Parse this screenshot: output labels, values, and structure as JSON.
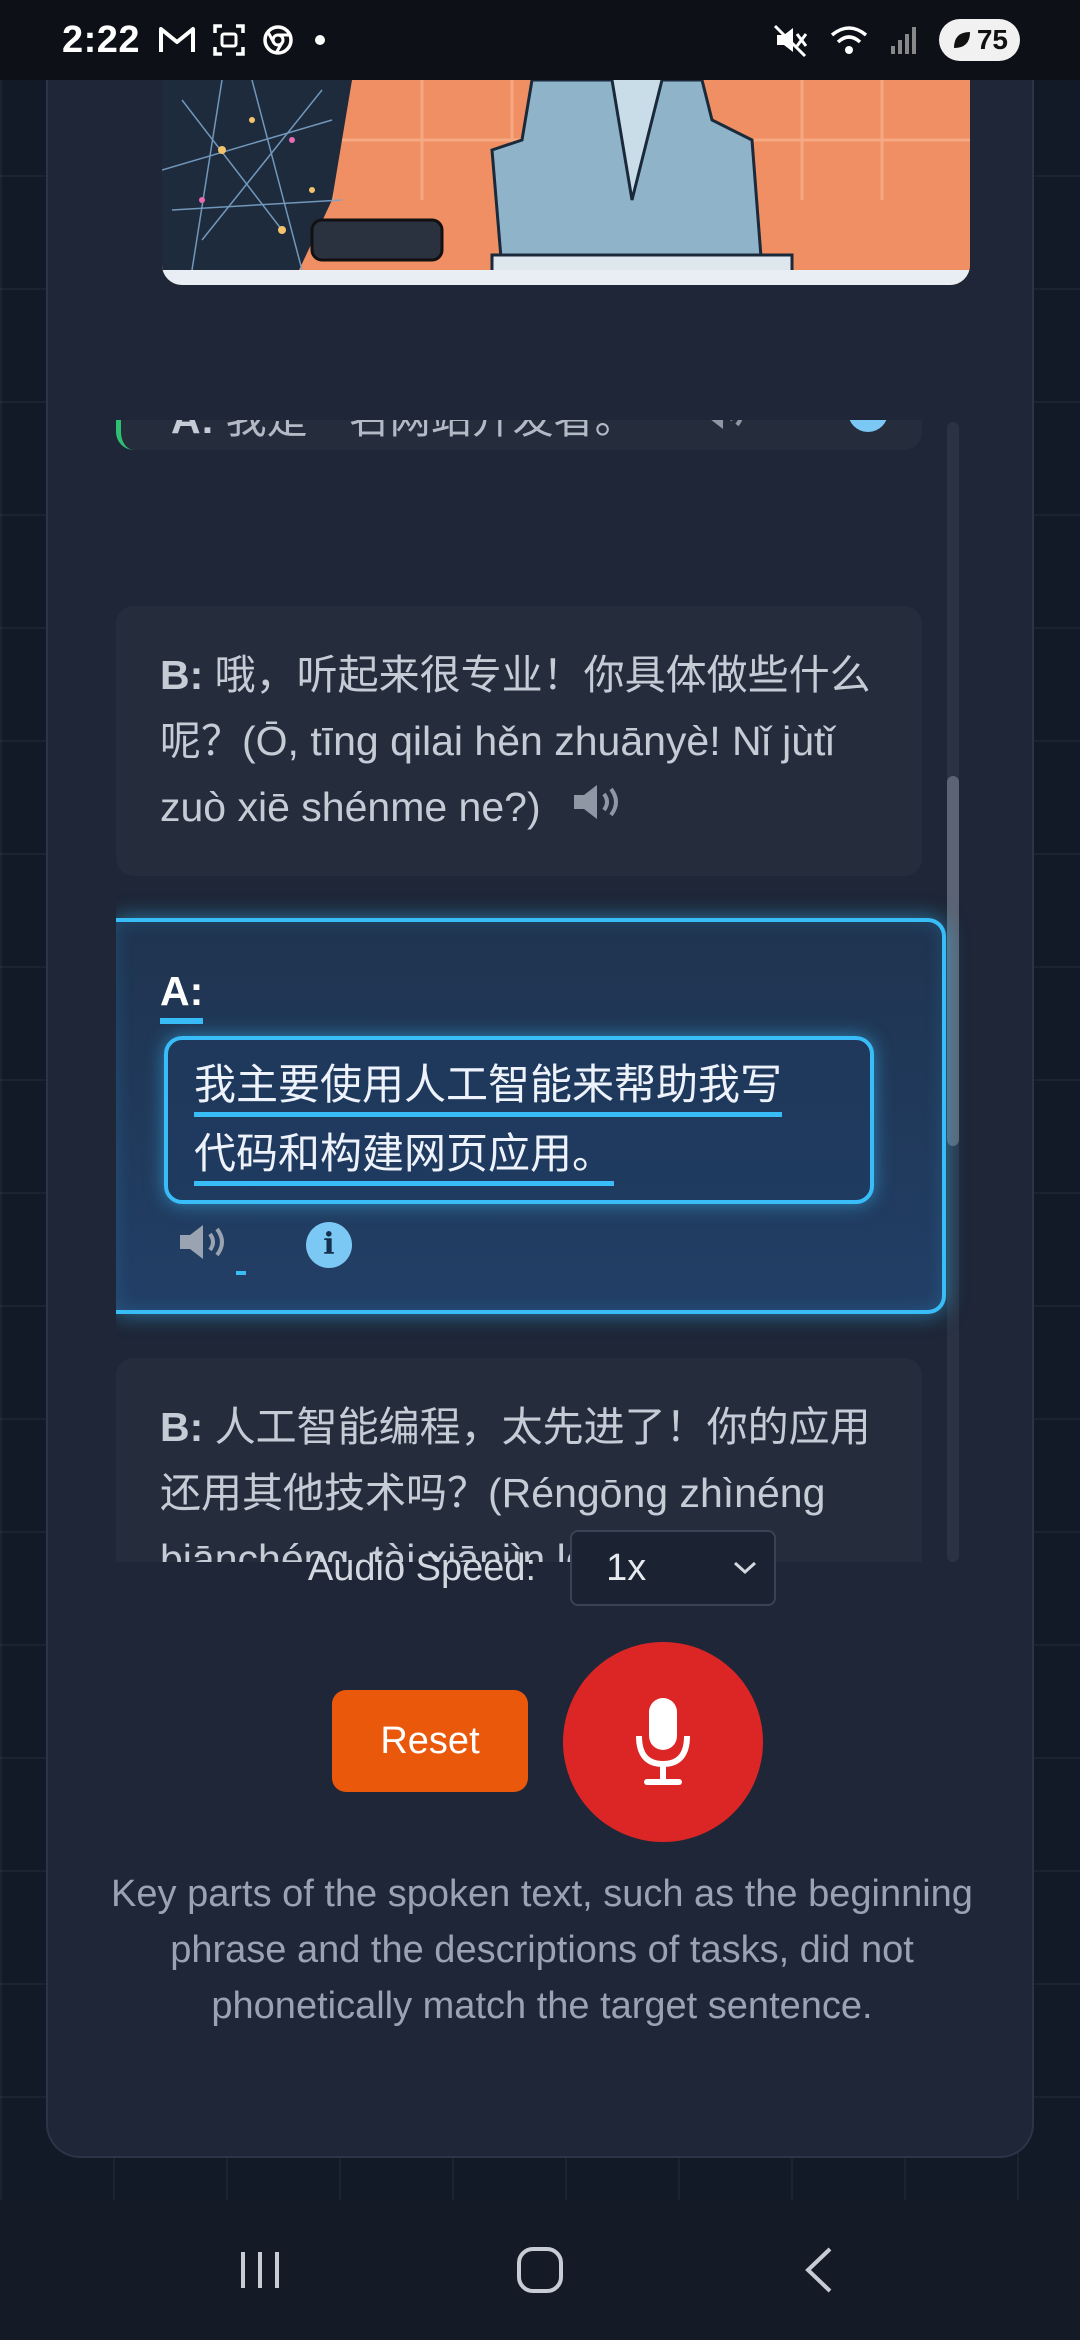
{
  "status_bar": {
    "time": "2:22",
    "battery": "75",
    "left_icons": [
      "gmail-icon",
      "screenshot-icon",
      "chrome-icon",
      "dot-icon"
    ],
    "right_icons": [
      "mute-icon",
      "wifi-icon",
      "signal-icon",
      "battery-icon"
    ]
  },
  "dialog": {
    "previous": {
      "speaker": "A:",
      "text": "我是一名网站开发者。"
    },
    "bubble_b1": {
      "speaker": "B:",
      "text": "哦，听起来很专业！你具体做些什么呢？(Ō, tīng qilai hěn zhuānyè! Nǐ jùtǐ zuò xiē shénme ne?)"
    },
    "active": {
      "speaker": "A:",
      "line1": "我主要使用人工智能来帮助我写",
      "line2": "代码和构建网页应用。"
    },
    "bubble_b2": {
      "speaker": "B:",
      "text": "人工智能编程，太先进了！你的应用还用其他技术吗？(Réngōng zhìnéng biānchéng, tài xiānjìn le!"
    }
  },
  "controls": {
    "audio_speed_label": "Audio Speed:",
    "audio_speed_value": "1x",
    "reset_label": "Reset"
  },
  "feedback": "Key parts of the spoken text, such as the beginning phrase and the descriptions of tasks, did not phonetically match the target sentence.",
  "colors": {
    "accent": "#38bdf8",
    "reset": "#ea580c",
    "mic": "#dc2626",
    "highlight_border": "#2fbf71"
  }
}
